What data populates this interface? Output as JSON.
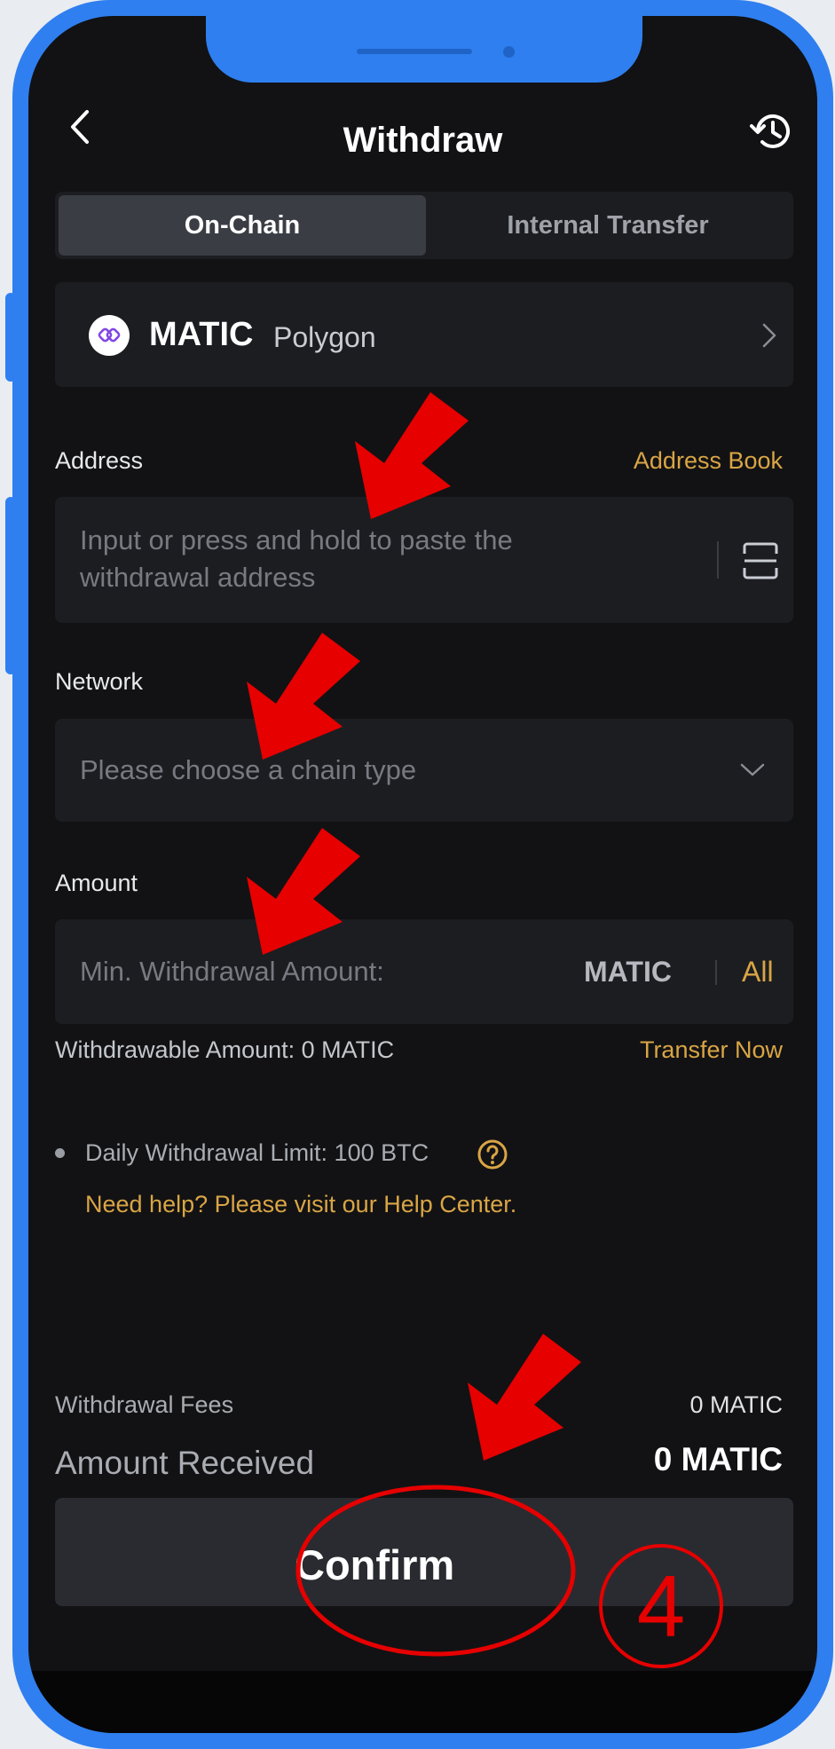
{
  "header": {
    "title": "Withdraw",
    "back_icon": "chevron-left-icon",
    "history_icon": "history-icon"
  },
  "tabs": [
    {
      "label": "On-Chain",
      "active": true
    },
    {
      "label": "Internal Transfer",
      "active": false
    }
  ],
  "coin": {
    "symbol": "MATIC",
    "name": "Polygon",
    "icon": "polygon-coin-icon",
    "chevron_icon": "chevron-right-icon"
  },
  "address": {
    "label": "Address",
    "book_link": "Address Book",
    "placeholder_line1": "Input or press and hold to paste the",
    "placeholder_line2": "withdrawal address",
    "scan_icon": "scan-icon"
  },
  "network": {
    "label": "Network",
    "placeholder": "Please choose a chain type",
    "dropdown_icon": "chevron-down-icon"
  },
  "amount": {
    "label": "Amount",
    "placeholder": "Min. Withdrawal Amount:",
    "unit": "MATIC",
    "all_button": "All",
    "withdrawable": "Withdrawable Amount: 0 MATIC",
    "transfer_link": "Transfer Now"
  },
  "limits": {
    "daily_limit": "Daily Withdrawal Limit: 100 BTC",
    "help_icon": "question-circle-icon",
    "help_link": "Need help? Please visit our Help Center."
  },
  "summary": {
    "fees_label": "Withdrawal Fees",
    "fees_value": "0 MATIC",
    "received_label": "Amount Received",
    "received_value": "0 MATIC"
  },
  "confirm": {
    "label": "Confirm",
    "step_number": "4"
  },
  "colors": {
    "accent_link": "#d9a545",
    "background": "#121214",
    "card": "#1c1d21",
    "frame": "#2f7ff0",
    "annotation": "#e60000"
  }
}
